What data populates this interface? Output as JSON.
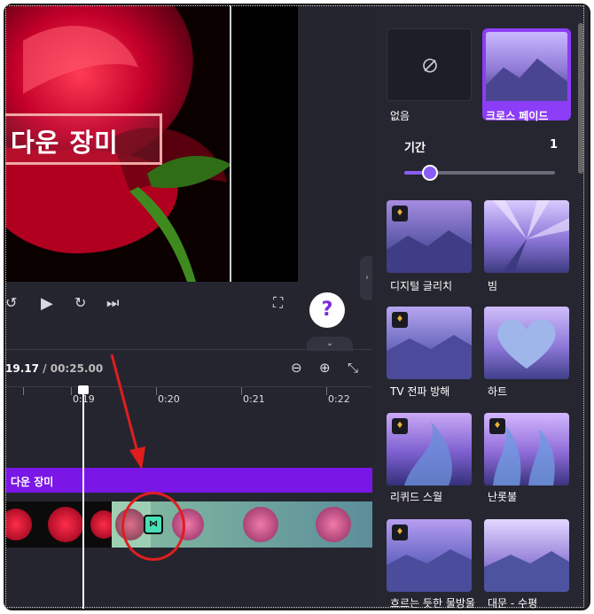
{
  "preview": {
    "title_text": "다운 장미"
  },
  "player": {
    "help": "?"
  },
  "timeline": {
    "current_time": "19.17",
    "total_time": "/ 00:25.00",
    "ticks": [
      "0:19",
      "0:20",
      "0:21",
      "0:22"
    ],
    "text_track_label": "다운 장미"
  },
  "transitions": {
    "duration_label": "기간",
    "duration_value": "1",
    "duration_level": 0.17,
    "items": [
      {
        "label": "없음",
        "premium": false,
        "selected": false
      },
      {
        "label": "크로스 페이드",
        "premium": false,
        "selected": true
      },
      {
        "label": "디지털 글리치",
        "premium": true,
        "selected": false
      },
      {
        "label": "빔",
        "premium": false,
        "selected": false
      },
      {
        "label": "TV 전파 방해",
        "premium": true,
        "selected": false
      },
      {
        "label": "하트",
        "premium": false,
        "selected": false
      },
      {
        "label": "리퀴드 스월",
        "premium": true,
        "selected": false
      },
      {
        "label": "난롯불",
        "premium": true,
        "selected": false
      },
      {
        "label": "흐르는 듯한 물방울",
        "premium": true,
        "selected": false
      },
      {
        "label": "대문 - 수평",
        "premium": false,
        "selected": false
      }
    ]
  },
  "colors": {
    "accent": "#7a16e6",
    "highlight": "#e01e1e",
    "transition_button": "#46e0b6"
  }
}
